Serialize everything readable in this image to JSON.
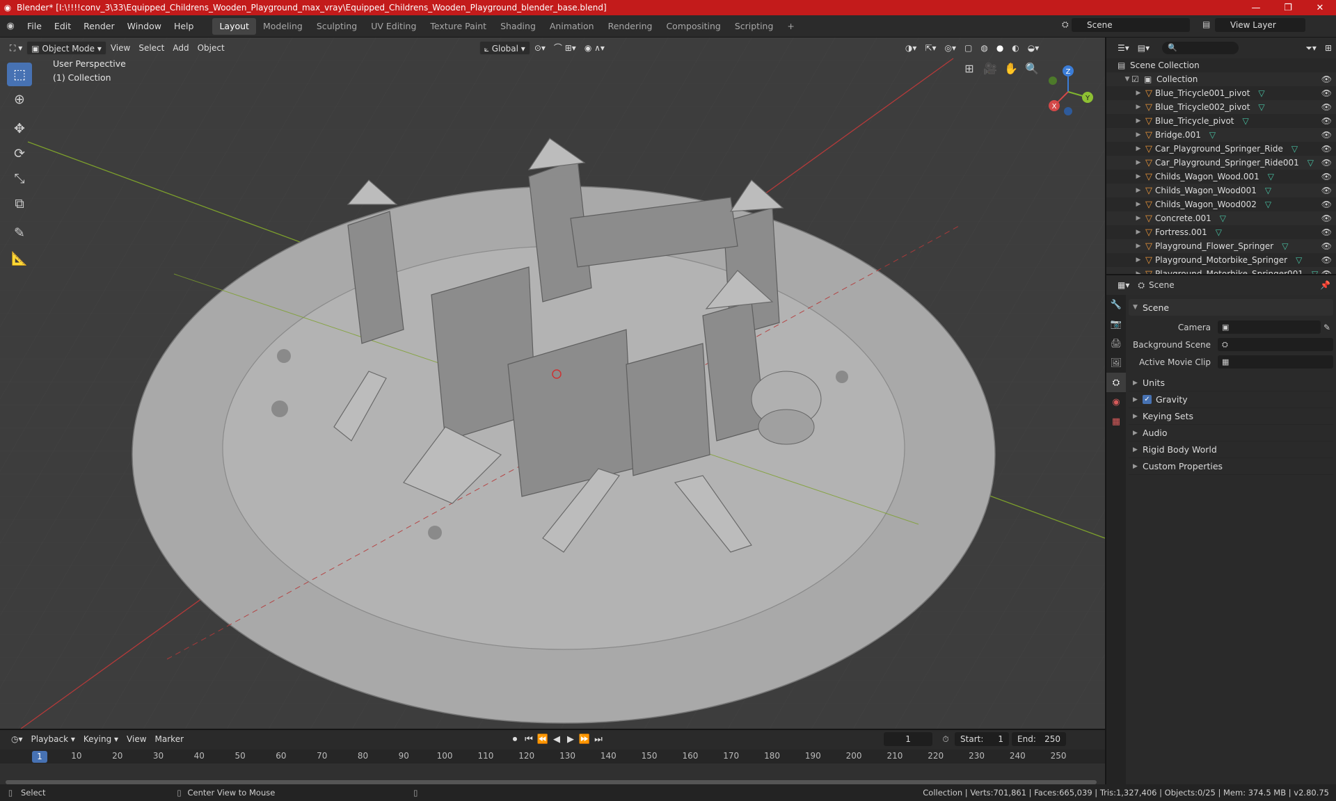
{
  "window": {
    "title": "Blender* [I:\\!!!!conv_3\\33\\Equipped_Childrens_Wooden_Playground_max_vray\\Equipped_Childrens_Wooden_Playground_blender_base.blend]",
    "minimize": "—",
    "maximize": "❐",
    "close": "✕"
  },
  "menu": [
    "File",
    "Edit",
    "Render",
    "Window",
    "Help"
  ],
  "workspaces": [
    "Layout",
    "Modeling",
    "Sculpting",
    "UV Editing",
    "Texture Paint",
    "Shading",
    "Animation",
    "Rendering",
    "Compositing",
    "Scripting"
  ],
  "active_workspace": "Layout",
  "scene_name": "Scene",
  "view_layer": "View Layer",
  "viewport": {
    "mode": "Object Mode",
    "menus": [
      "View",
      "Select",
      "Add",
      "Object"
    ],
    "transform_orientation": "Global",
    "perspective_label": "User Perspective",
    "collection_label": "(1) Collection",
    "gizmo": {
      "z": "Z",
      "y": "Y",
      "x": "X"
    }
  },
  "outliner": {
    "root": "Scene Collection",
    "collection": "Collection",
    "items": [
      "Blue_Tricycle001_pivot",
      "Blue_Tricycle002_pivot",
      "Blue_Tricycle_pivot",
      "Bridge.001",
      "Car_Playground_Springer_Ride",
      "Car_Playground_Springer_Ride001",
      "Childs_Wagon_Wood.001",
      "Childs_Wagon_Wood001",
      "Childs_Wagon_Wood002",
      "Concrete.001",
      "Fortress.001",
      "Playground_Flower_Springer",
      "Playground_Motorbike_Springer",
      "Playground_Motorbike_Springer001"
    ]
  },
  "properties": {
    "header": "Scene",
    "panel": "Scene",
    "camera_label": "Camera",
    "background_scene_label": "Background Scene",
    "active_clip_label": "Active Movie Clip",
    "sections": [
      "Units",
      "Gravity",
      "Keying Sets",
      "Audio",
      "Rigid Body World",
      "Custom Properties"
    ]
  },
  "timeline": {
    "menus": [
      "Playback",
      "Keying",
      "View",
      "Marker"
    ],
    "current_frame": "1",
    "start_label": "Start:",
    "start": "1",
    "end_label": "End:",
    "end": "250",
    "ticks": [
      "10",
      "20",
      "30",
      "40",
      "50",
      "60",
      "70",
      "80",
      "90",
      "100",
      "110",
      "120",
      "130",
      "140",
      "150",
      "160",
      "170",
      "180",
      "190",
      "200",
      "210",
      "220",
      "230",
      "240",
      "250"
    ]
  },
  "status": {
    "left1": "Select",
    "left2": "Center View to Mouse",
    "right": "Collection | Verts:701,861 | Faces:665,039 | Tris:1,327,406 | Objects:0/25 | Mem: 374.5 MB | v2.80.75"
  }
}
